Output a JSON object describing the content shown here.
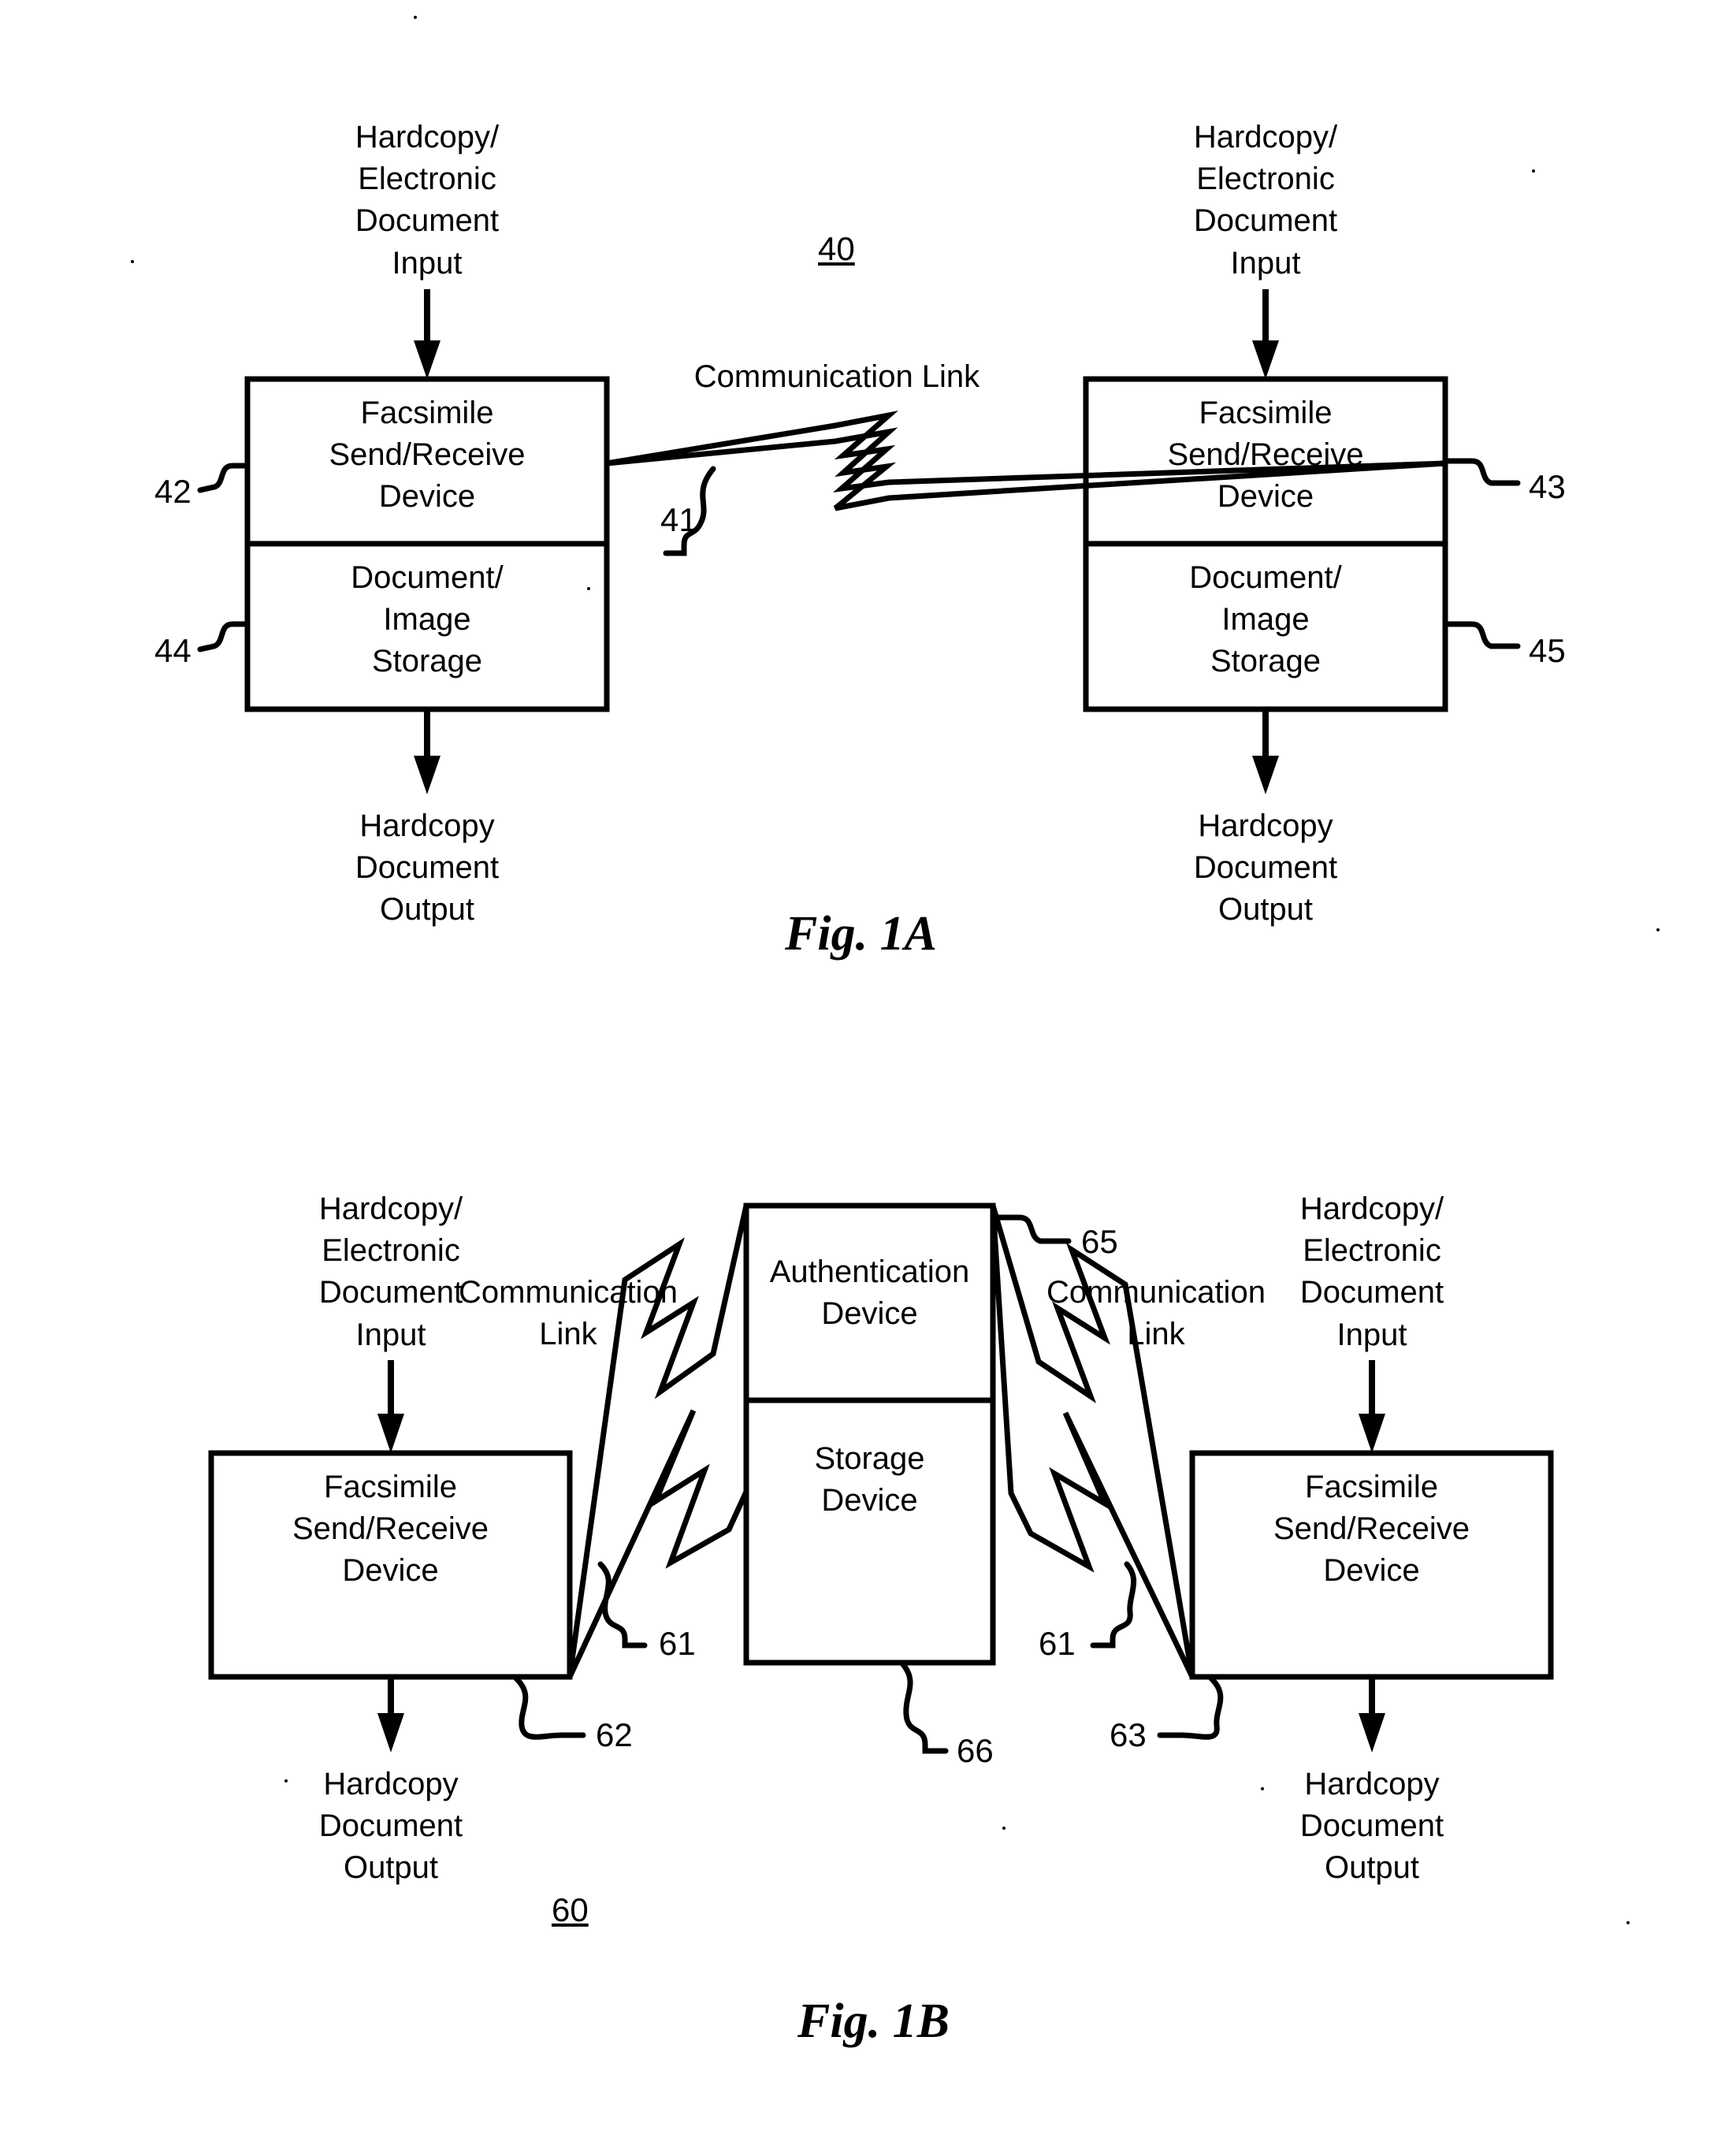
{
  "figures": [
    {
      "id": "fig1a",
      "caption": "Fig. 1A",
      "system_number": "40",
      "nodes": {
        "left_input": "Hardcopy/\nElectronic\nDocument\nInput",
        "left_fax": "Facsimile\nSend/Receive\nDevice",
        "left_storage": "Document/\nImage\nStorage",
        "left_output": "Hardcopy\nDocument\nOutput",
        "right_input": "Hardcopy/\nElectronic\nDocument\nInput",
        "right_fax": "Facsimile\nSend/Receive\nDevice",
        "right_storage": "Document/\nImage\nStorage",
        "right_output": "Hardcopy\nDocument\nOutput",
        "link_label": "Communication Link"
      },
      "refs": {
        "left_fax": "42",
        "left_storage": "44",
        "link": "41",
        "right_fax": "43",
        "right_storage": "45"
      }
    },
    {
      "id": "fig1b",
      "caption": "Fig. 1B",
      "system_number": "60",
      "nodes": {
        "left_input": "Hardcopy/\nElectronic\nDocument\nInput",
        "left_fax": "Facsimile\nSend/Receive\nDevice",
        "left_output": "Hardcopy\nDocument\nOutput",
        "center_auth": "Authentication\nDevice",
        "center_storage": "Storage\nDevice",
        "right_input": "Hardcopy/\nElectronic\nDocument\nInput",
        "right_fax": "Facsimile\nSend/Receive\nDevice",
        "right_output": "Hardcopy\nDocument\nOutput",
        "left_link_label": "Communication\nLink",
        "right_link_label": "Communication\nLink"
      },
      "refs": {
        "left_link": "61",
        "right_link": "61",
        "left_fax": "62",
        "right_fax": "63",
        "auth": "65",
        "storage": "66"
      }
    }
  ],
  "style": {
    "stroke": "#000000",
    "background": "#ffffff"
  }
}
